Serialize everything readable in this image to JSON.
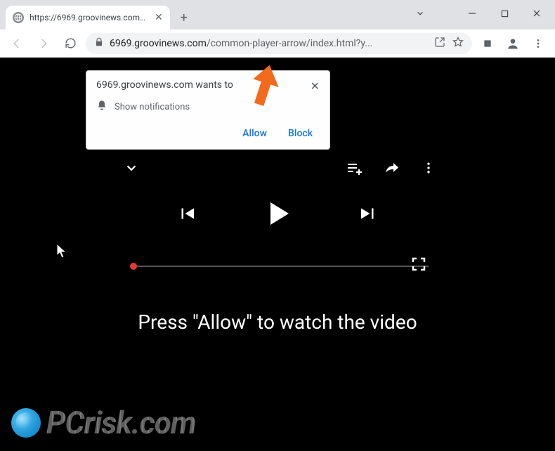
{
  "window": {
    "tab_title": "https://6969.groovinews.com/co"
  },
  "toolbar": {
    "url_host": "6969.groovinews.com",
    "url_path": "/common-player-arrow/index.html?y..."
  },
  "notification": {
    "title": "6969.groovinews.com wants to",
    "message": "Show notifications",
    "allow": "Allow",
    "block": "Block"
  },
  "page": {
    "message": "Press \"Allow\" to watch the video"
  },
  "watermark": {
    "text": "PCrisk.com"
  }
}
